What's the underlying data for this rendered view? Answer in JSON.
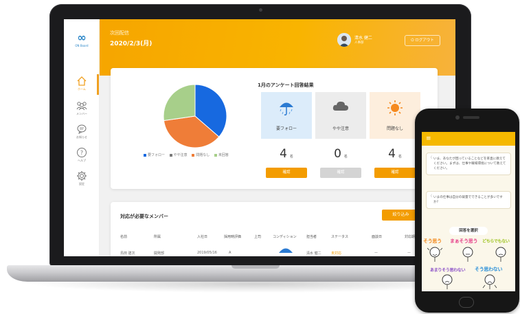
{
  "sidebar": {
    "logo_text": "ON Board",
    "items": [
      {
        "label": "ホーム",
        "icon": "home-icon",
        "active": true
      },
      {
        "label": "メンバー",
        "icon": "members-icon",
        "active": false
      },
      {
        "label": "お知らせ",
        "icon": "chat-icon",
        "active": false
      },
      {
        "label": "ヘルプ",
        "icon": "help-icon",
        "active": false
      },
      {
        "label": "設定",
        "icon": "gear-icon",
        "active": false
      }
    ]
  },
  "header": {
    "next_delivery_label": "次回配信",
    "next_delivery_date": "2020/2/3(月)",
    "user_name": "清水 健二",
    "user_department": "人事部",
    "logout_label": "ログアウト"
  },
  "survey": {
    "title": "1月のアンケート回答結果",
    "legend": [
      {
        "label": "要フォロー",
        "color": "#1769e0"
      },
      {
        "label": "やや注意",
        "color": "#7a7a7a"
      },
      {
        "label": "問題なし",
        "color": "#ef7d38"
      },
      {
        "label": "未回答",
        "color": "#a7cf8a"
      }
    ],
    "stats": [
      {
        "label": "要フォロー",
        "value": "4",
        "unit": "名",
        "button": "確認",
        "icon": "umbrella-rain-icon"
      },
      {
        "label": "やや注意",
        "value": "0",
        "unit": "名",
        "button": "確認",
        "icon": "cloud-icon"
      },
      {
        "label": "問題なし",
        "value": "4",
        "unit": "名",
        "button": "確認",
        "icon": "sun-icon"
      }
    ]
  },
  "chart_data": {
    "type": "pie",
    "labels": [
      "要フォロー",
      "問題なし",
      "未回答"
    ],
    "values": [
      4,
      4,
      3
    ],
    "colors": [
      "#1769e0",
      "#ef7d38",
      "#a7cf8a"
    ]
  },
  "members": {
    "title": "対応が必要なメンバー",
    "filter_label": "絞り込み",
    "columns": [
      "名前",
      "所属",
      "入社日",
      "採用時評価",
      "上司",
      "コンディション",
      "担当者",
      "ステータス",
      "面談日",
      "対応期"
    ],
    "rows": [
      [
        "島田 建次",
        "開発部",
        "2019/05/16",
        "A",
        "",
        "",
        "清水 健二",
        "未対応",
        "ー",
        "ー"
      ]
    ]
  },
  "phone": {
    "messages": [
      "いま、あなたが困っていることなどを率直に教えてください。まずは、仕事や職場環境について教えてください。",
      "いまの仕事は自分の裁量でできることが多いですか?"
    ],
    "choose_label": "回答を選択",
    "choices": [
      {
        "label": "そう思う",
        "color": "#f28a1e"
      },
      {
        "label": "まぁそう思う",
        "color": "#e6458c"
      },
      {
        "label": "どちらでもない",
        "color": "#9cc31c"
      },
      {
        "label": "あまりそう思わない",
        "color": "#8a4fc7"
      },
      {
        "label": "そう思わない",
        "color": "#2a8fd8"
      }
    ]
  }
}
